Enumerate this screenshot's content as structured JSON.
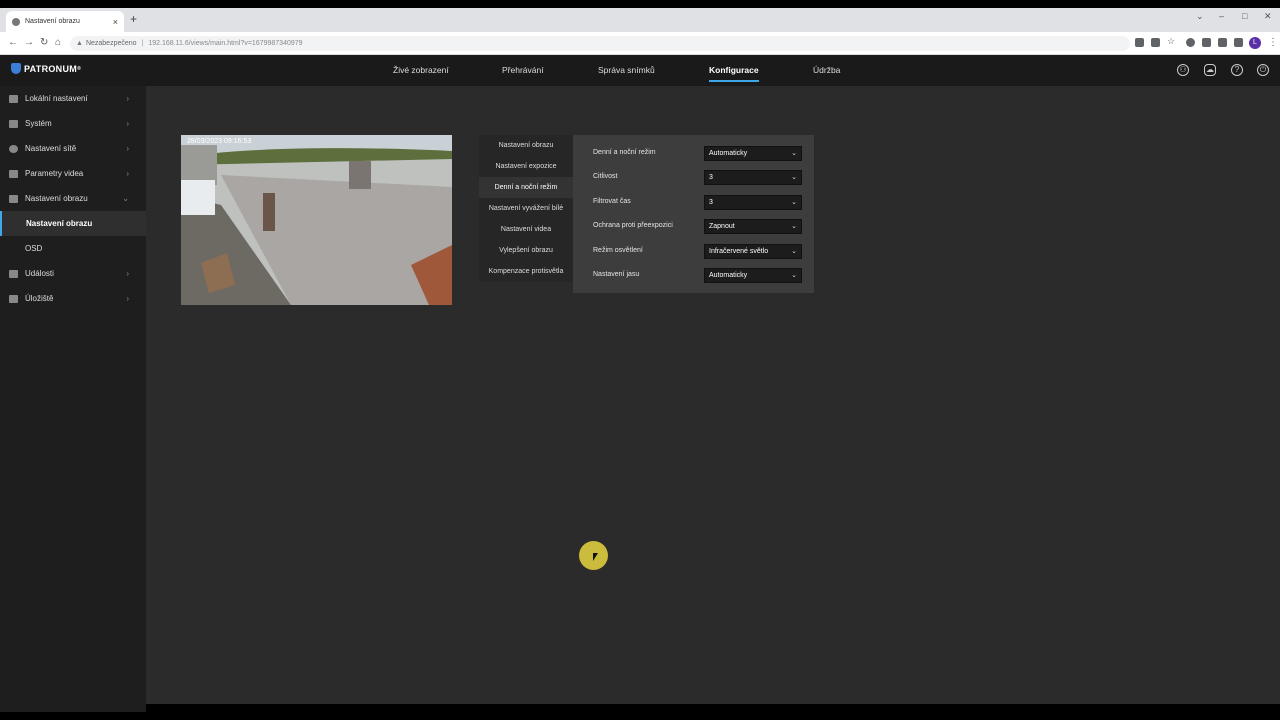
{
  "browser": {
    "tab_title": "Nastavení obrazu",
    "security_label": "Nezabezpečeno",
    "url": "192.168.11.6/views/main.html?v=1679987340979",
    "profile_initial": "L"
  },
  "app": {
    "logo": "PATRONUM",
    "logo_mark": "®",
    "nav": [
      "Živé zobrazení",
      "Přehrávání",
      "Správa snímků",
      "Konfigurace",
      "Údržba"
    ],
    "active_nav": "Konfigurace"
  },
  "sidebar": {
    "items": [
      {
        "label": "Lokální nastavení",
        "expanded": false
      },
      {
        "label": "Systém",
        "expanded": false
      },
      {
        "label": "Nastavení sítě",
        "expanded": false
      },
      {
        "label": "Parametry videa",
        "expanded": false
      },
      {
        "label": "Nastavení obrazu",
        "expanded": true
      },
      {
        "label": "Nastavení obrazu",
        "sub": true,
        "active": true
      },
      {
        "label": "OSD",
        "sub": true
      },
      {
        "label": "Události",
        "expanded": false
      },
      {
        "label": "Úložiště",
        "expanded": false
      }
    ]
  },
  "preview": {
    "timestamp": "28/03/2023 09:16:53"
  },
  "subnav": {
    "items": [
      "Nastavení obrazu",
      "Nastavení expozice",
      "Denní a noční režim",
      "Nastavení vyvážení bílé",
      "Nastavení videa",
      "Vylepšení obrazu",
      "Kompenzace protisvětla"
    ],
    "active": "Denní a noční režim"
  },
  "form": {
    "fields": [
      {
        "label": "Denní a noční režim",
        "value": "Automaticky"
      },
      {
        "label": "Citlivost",
        "value": "3"
      },
      {
        "label": "Filtrovat čas",
        "value": "3"
      },
      {
        "label": "Ochrana proti přeexpozici",
        "value": "Zapnout"
      },
      {
        "label": "Režim osvětlení",
        "value": "Infračervené světlo"
      },
      {
        "label": "Nastavení jasu",
        "value": "Automaticky"
      }
    ]
  },
  "colors": {
    "accent": "#3fa7e8",
    "cursor_highlight": "#e8d63f"
  }
}
